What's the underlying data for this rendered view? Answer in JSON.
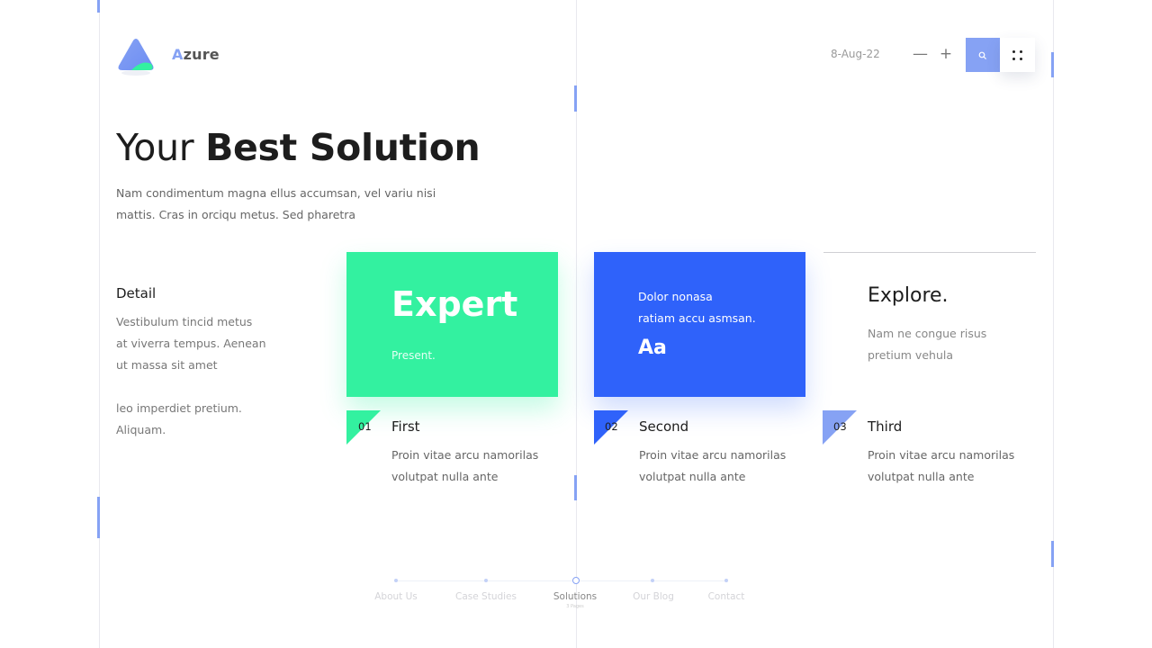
{
  "header": {
    "brand_first": "A",
    "brand_rest": "zure",
    "date": "8-Aug-22",
    "zoom_out": "—",
    "zoom_in": "+",
    "search_icon": "search-icon",
    "menu_icon": "grid-dots-icon"
  },
  "hero": {
    "title_light": "Your",
    "title_bold": "Best Solution",
    "desc_line1": "Nam condimentum  magna ellus accumsan, vel variu nisi",
    "desc_line2": "mattis. Cras in orciqu metus. Sed pharetra"
  },
  "detail": {
    "title": "Detail",
    "line1": "Vestibulum  tincid metus",
    "line2": "at viverra  tempus.  Aenean",
    "line3": "ut massa sit amet",
    "line4": "leo imperdiet pretium.",
    "line5": "Aliquam."
  },
  "cards": {
    "green": {
      "big": "Expert",
      "small": "Present."
    },
    "blue": {
      "line1": "Dolor nonasa",
      "line2": "ratiam accu asmsan.",
      "big": "Aa"
    },
    "explore": {
      "title": "Explore.",
      "line1": "Nam ne congue  risus",
      "line2": "pretium vehula"
    }
  },
  "steps": [
    {
      "num": "01",
      "title": "First",
      "line1": "Proin vitae arcu namorilas",
      "line2": "volutpat nulla ante",
      "color": "#33f1a0"
    },
    {
      "num": "02",
      "title": "Second",
      "line1": "Proin vitae arcu namorilas",
      "line2": "volutpat nulla ante",
      "color": "#2f62fa"
    },
    {
      "num": "03",
      "title": "Third",
      "line1": "Proin vitae arcu namorilas",
      "line2": "volutpat nulla ante",
      "color": "#86a2f4"
    }
  ],
  "nav": {
    "items": [
      "About Us",
      "Case Studies",
      "Solutions",
      "Our Blog",
      "Contact"
    ],
    "active": "Solutions",
    "active_sub": "3 Pages"
  },
  "colors": {
    "accent": "#86a2f4",
    "green": "#33f1a0",
    "blue": "#2f62fa"
  }
}
